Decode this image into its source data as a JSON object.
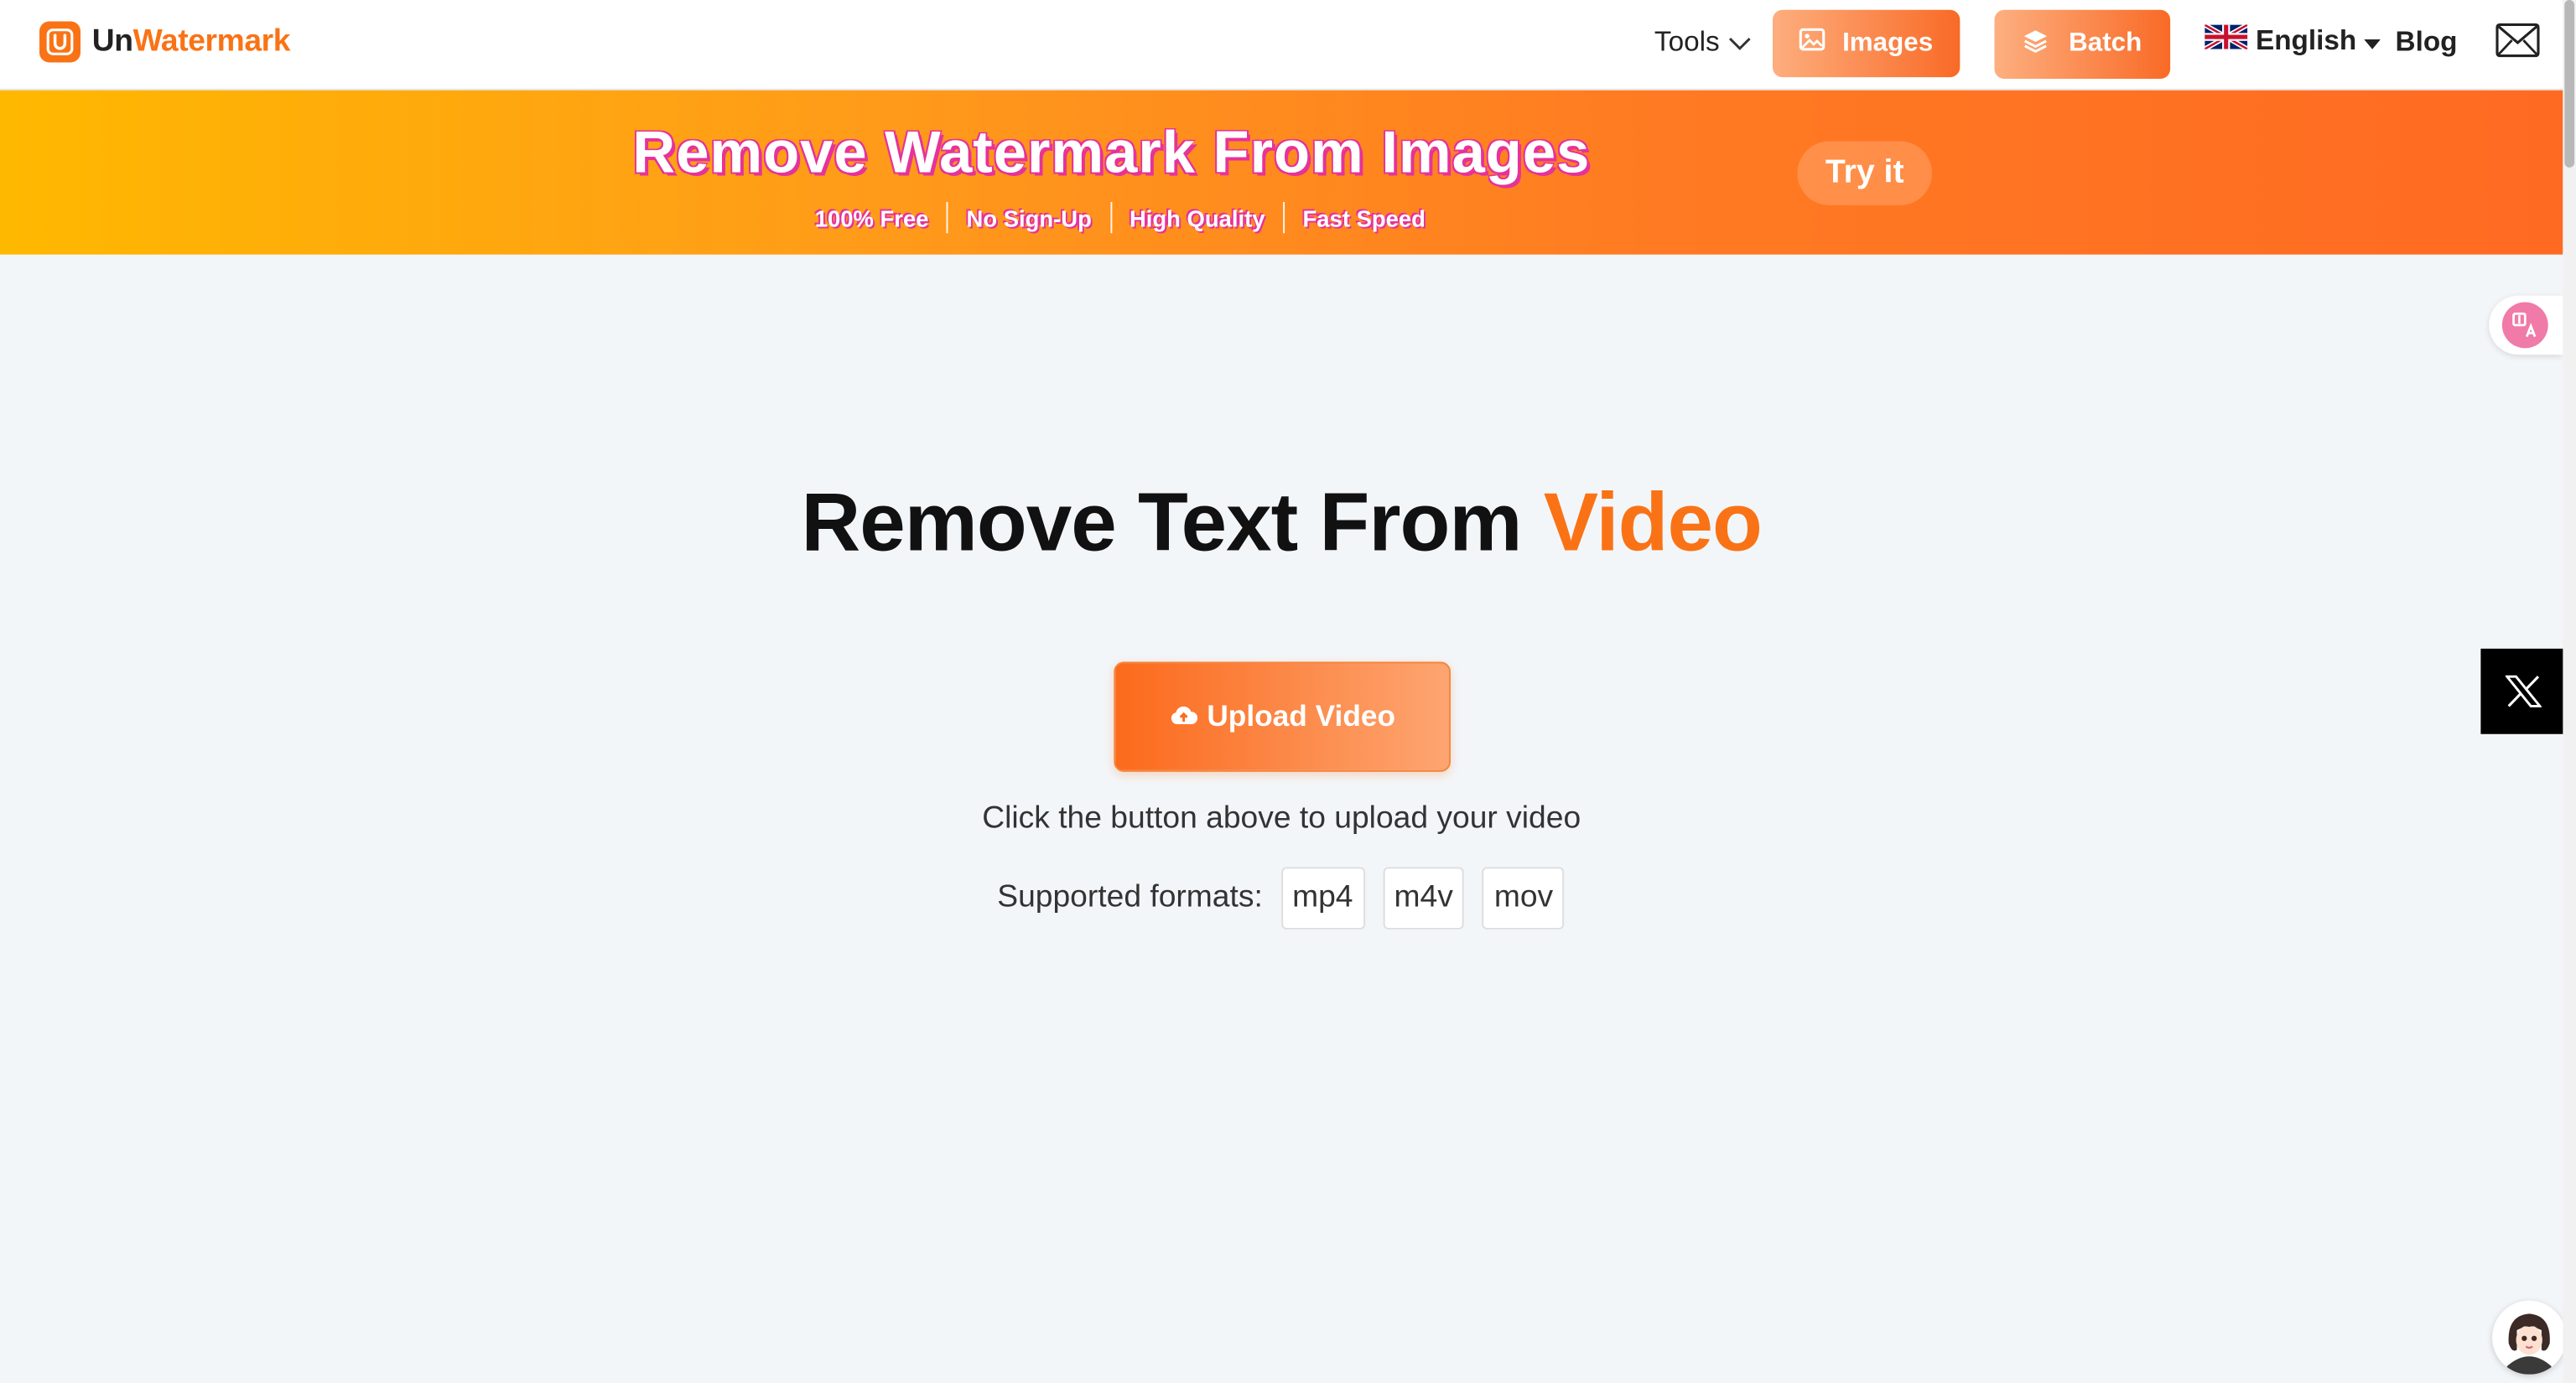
{
  "header": {
    "logo": {
      "prefix": "Un",
      "accent": "Watermark"
    },
    "tools_label": "Tools",
    "images_label": "Images",
    "batch_label": "Batch",
    "language_label": "English",
    "blog_label": "Blog"
  },
  "banner": {
    "title": "Remove Watermark From Images",
    "features": [
      "100% Free",
      "No Sign-Up",
      "High Quality",
      "Fast Speed"
    ],
    "cta_label": "Try it"
  },
  "main": {
    "title_prefix": "Remove Text From",
    "title_accent": "Video",
    "upload_label": "Upload Video",
    "upload_hint": "Click the button above to upload your video",
    "formats_label": "Supported formats:",
    "formats": [
      "mp4",
      "m4v",
      "mov"
    ]
  },
  "icons": {
    "logo": "logo-u-icon",
    "tools": "chevron-down-icon",
    "images": "image-icon",
    "batch": "layers-icon",
    "language": "uk-flag-icon",
    "mail": "mail-icon",
    "upload": "cloud-upload-icon",
    "translate": "translate-icon",
    "social": "x-logo-icon",
    "assistant": "assistant-avatar-icon"
  },
  "colors": {
    "accent": "#f97316",
    "banner_start": "#ffb800",
    "banner_end": "#ff6a22",
    "banner_text_shadow": "#e6329a"
  }
}
